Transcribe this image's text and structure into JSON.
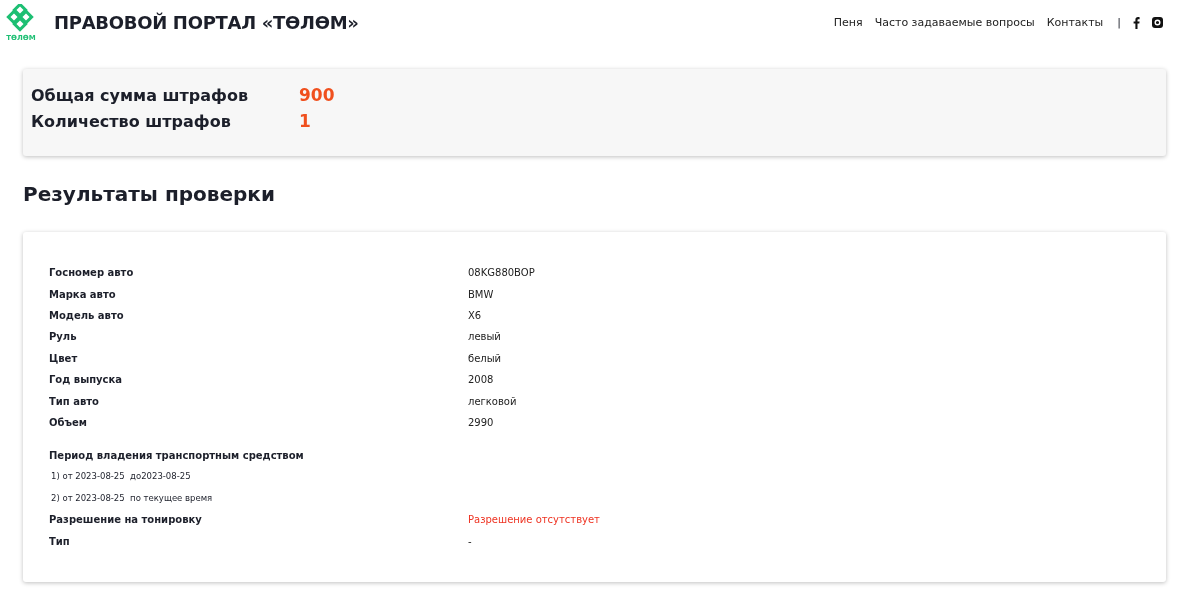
{
  "header": {
    "logo_text": "ТӨЛӨМ",
    "title": "ПРАВОВОЙ ПОРТАЛ «ТӨЛӨМ»",
    "nav": [
      "Пеня",
      "Часто задаваемые вопросы",
      "Контакты"
    ],
    "separator": "|"
  },
  "summary": [
    {
      "label": "Общая сумма штрафов",
      "value": "900"
    },
    {
      "label": "Количество штрафов",
      "value": "1"
    }
  ],
  "results_title": "Результаты проверки",
  "details": [
    {
      "label": "Госномер авто",
      "value": "08KG880BOP",
      "warning": false
    },
    {
      "label": "Марка авто",
      "value": "BMW",
      "warning": false
    },
    {
      "label": "Модель авто",
      "value": "X6",
      "warning": false
    },
    {
      "label": "Руль",
      "value": "левый",
      "warning": false
    },
    {
      "label": "Цвет",
      "value": "белый",
      "warning": false
    },
    {
      "label": "Год выпуска",
      "value": "2008",
      "warning": false
    },
    {
      "label": "Тип авто",
      "value": "легковой",
      "warning": false
    },
    {
      "label": "Объем",
      "value": "2990",
      "warning": false
    }
  ],
  "ownership": {
    "title": "Период владения транспортным средством",
    "periods": [
      "1) от 2023-08-25  до2023-08-25",
      "2) от 2023-08-25  по текущее время"
    ]
  },
  "extra": [
    {
      "label": "Разрешение на тонировку",
      "value": "Разрешение отсутствует",
      "warning": true
    },
    {
      "label": "Тип",
      "value": "-",
      "warning": false
    }
  ]
}
